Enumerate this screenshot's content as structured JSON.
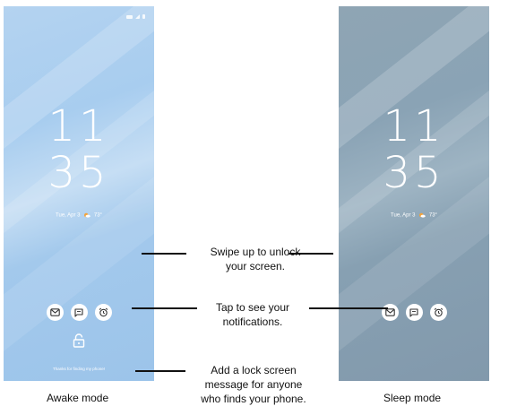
{
  "phones": {
    "awake": {
      "time_hour": "11",
      "time_minute": "35",
      "date": "Tue, Apr 3",
      "temperature": "73°",
      "lock_message": "Thanks for finding my phone!",
      "background_color": "#a8cdef"
    },
    "sleep": {
      "time_hour": "11",
      "time_minute": "35",
      "date": "Tue, Apr 3",
      "temperature": "73°",
      "background_color": "#8aa3b5"
    }
  },
  "callouts": {
    "swipe": {
      "line1": "Swipe up to unlock",
      "line2": "your screen."
    },
    "tap": {
      "line1": "Tap to see your",
      "line2": "notifications."
    },
    "message": {
      "line1": "Add a lock screen",
      "line2": "message for anyone",
      "line3": "who finds your phone."
    }
  },
  "captions": {
    "awake": "Awake mode",
    "sleep": "Sleep mode"
  },
  "icons": [
    "message-icon",
    "chat-icon",
    "alarm-icon",
    "lock-icon",
    "weather-icon"
  ]
}
